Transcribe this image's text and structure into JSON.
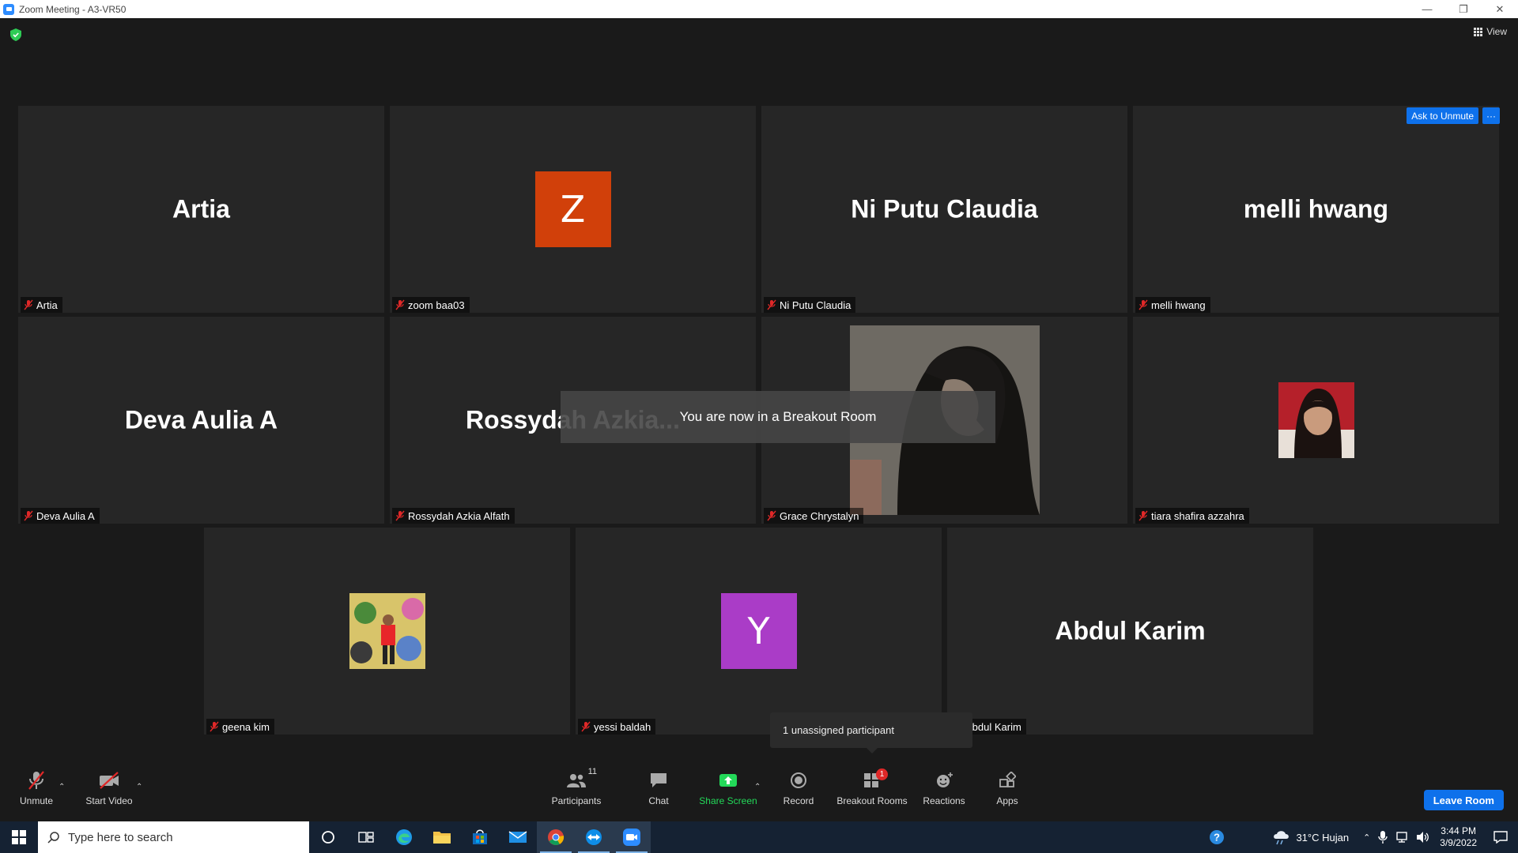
{
  "window": {
    "title": "Zoom Meeting - A3-VR50"
  },
  "top": {
    "view_label": "View"
  },
  "tiles": [
    {
      "big": "Artia",
      "label": "Artia"
    },
    {
      "letter": "Z",
      "color": "#d1400a",
      "label": "zoom baa03"
    },
    {
      "big": "Ni Putu Claudia",
      "label": "Ni Putu Claudia"
    },
    {
      "big": "melli hwang",
      "label": "melli hwang"
    },
    {
      "big": "Deva Aulia A",
      "label": "Deva Aulia A"
    },
    {
      "big": "Rossydah  Azkia...",
      "label": "Rossydah Azkia Alfath"
    },
    {
      "label": "Grace Chrystalyn"
    },
    {
      "label": "tiara shafira azzahra"
    },
    {
      "label": "geena kim"
    },
    {
      "letter": "Y",
      "color": "#aa3cc7",
      "label": "yessi baldah"
    },
    {
      "big": "Abdul Karim",
      "label": "Abdul Karim"
    }
  ],
  "ask_unmute": "Ask to Unmute",
  "more": "···",
  "toast": "You are now in a Breakout Room",
  "tooltip": "1 unassigned participant",
  "toolbar": {
    "unmute": "Unmute",
    "start_video": "Start Video",
    "participants": "Participants",
    "participants_count": "11",
    "chat": "Chat",
    "share_screen": "Share Screen",
    "record": "Record",
    "breakout_rooms": "Breakout Rooms",
    "breakout_badge": "1",
    "reactions": "Reactions",
    "apps": "Apps",
    "leave_room": "Leave Room"
  },
  "taskbar": {
    "search_placeholder": "Type here to search",
    "weather": "31°C  Hujan",
    "time": "3:44 PM",
    "date": "3/9/2022"
  },
  "colors": {
    "accent": "#0e71eb",
    "share_green": "#23d959",
    "mute_red": "#e02828"
  }
}
